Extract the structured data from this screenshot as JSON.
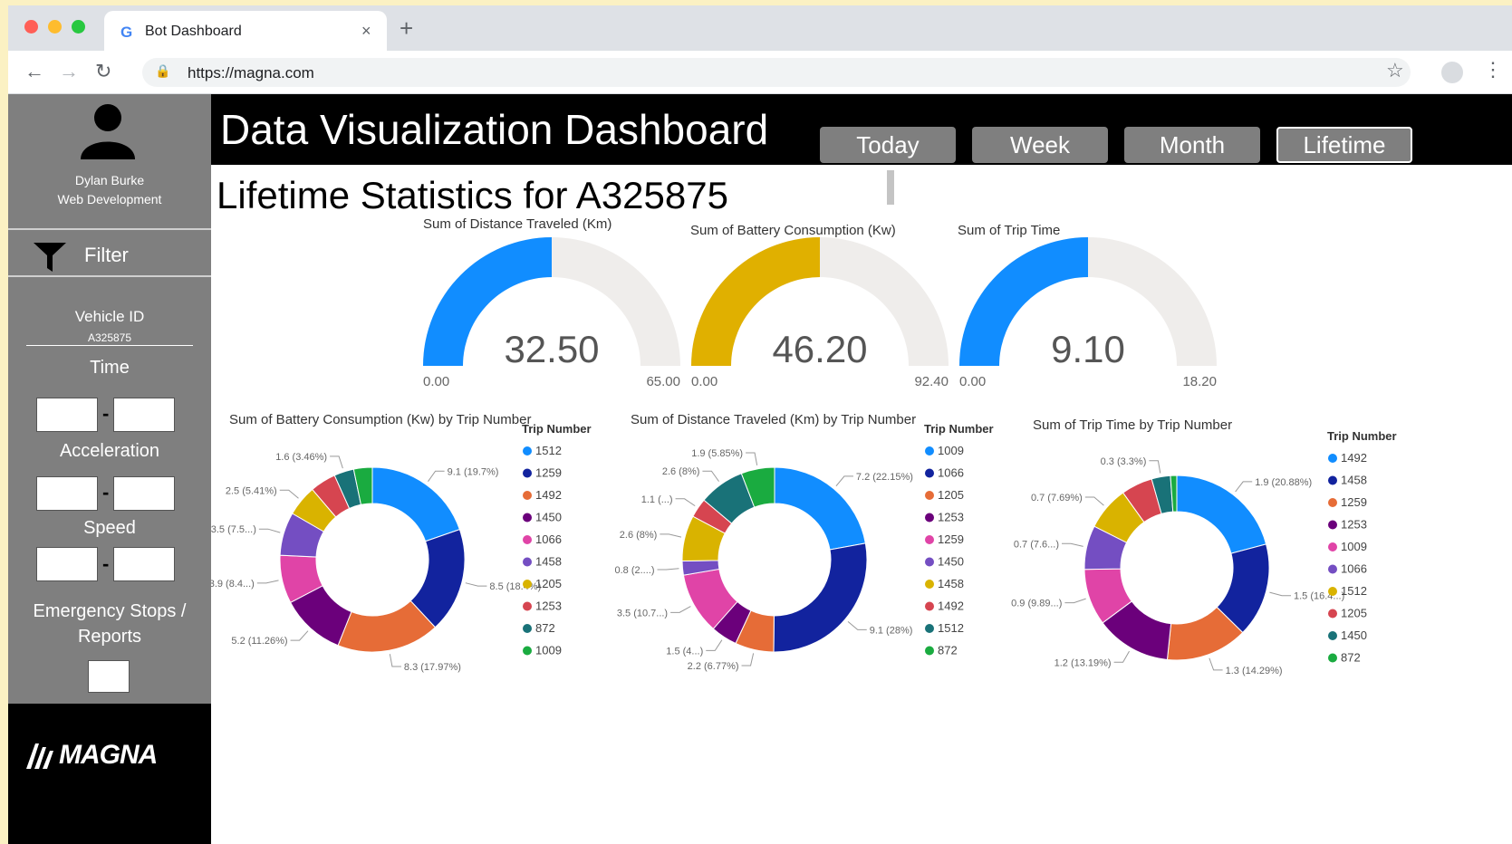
{
  "browser": {
    "tab_title": "Bot Dashboard",
    "url": "https://magna.com",
    "tab_close": "×",
    "new_tab": "+"
  },
  "sidebar": {
    "user_name": "Dylan Burke",
    "user_dept": "Web Development",
    "filter_label": "Filter",
    "vehicle_id_label": "Vehicle ID",
    "vehicle_id_value": "A325875",
    "time_label": "Time",
    "acceleration_label": "Acceleration",
    "speed_label": "Speed",
    "emergency_label_1": "Emergency Stops /",
    "emergency_label_2": "Reports",
    "range_dash": "-",
    "logo_text": "MAGNA"
  },
  "header": {
    "title": "Data Visualization Dashboard",
    "ranges": [
      "Today",
      "Week",
      "Month",
      "Lifetime"
    ],
    "active_range": "Lifetime"
  },
  "main": {
    "stats_title": "Lifetime Statistics for A325875"
  },
  "chart_data": [
    {
      "type": "gauge",
      "title": "Sum of Distance Traveled (Km)",
      "value": 32.5,
      "value_label": "32.50",
      "min": 0,
      "min_label": "0.00",
      "max": 65,
      "max_label": "65.00",
      "color": "#118dff"
    },
    {
      "type": "gauge",
      "title": "Sum of Battery Consumption (Kw)",
      "value": 46.2,
      "value_label": "46.20",
      "min": 0,
      "min_label": "0.00",
      "max": 92.4,
      "max_label": "92.40",
      "color": "#e0b000"
    },
    {
      "type": "gauge",
      "title": "Sum of Trip Time",
      "value": 9.1,
      "value_label": "9.10",
      "min": 0,
      "min_label": "0.00",
      "max": 18.2,
      "max_label": "18.20",
      "color": "#118dff"
    },
    {
      "type": "pie",
      "title": "Sum of Battery Consumption (Kw) by Trip Number",
      "legend_title": "Trip Number",
      "slices": [
        {
          "name": "1512",
          "value": 9.1,
          "label": "9.1 (19.7%)",
          "color": "#118dff"
        },
        {
          "name": "1259",
          "value": 8.5,
          "label": "8.5 (18.4%)",
          "color": "#12239e"
        },
        {
          "name": "1492",
          "value": 8.3,
          "label": "8.3 (17.97%)",
          "color": "#e66c37"
        },
        {
          "name": "1450",
          "value": 5.2,
          "label": "5.2 (11.26%)",
          "color": "#6b007b"
        },
        {
          "name": "1066",
          "value": 3.9,
          "label": "3.9 (8.4...)",
          "color": "#e044a7"
        },
        {
          "name": "1458",
          "value": 3.5,
          "label": "3.5 (7.5...)",
          "color": "#744ec2"
        },
        {
          "name": "1205",
          "value": 2.5,
          "label": "2.5 (5.41%)",
          "color": "#d9b300"
        },
        {
          "name": "1253",
          "value": 2.1,
          "label": "",
          "color": "#d64550"
        },
        {
          "name": "872",
          "value": 1.6,
          "label": "1.6 (3.46%)",
          "color": "#197278"
        },
        {
          "name": "1009",
          "value": 1.5,
          "label": "",
          "color": "#1aab40"
        }
      ]
    },
    {
      "type": "pie",
      "title": "Sum of Distance Traveled (Km) by Trip Number",
      "legend_title": "Trip Number",
      "slices": [
        {
          "name": "1009",
          "value": 7.2,
          "label": "7.2 (22.15%)",
          "color": "#118dff"
        },
        {
          "name": "1066",
          "value": 9.1,
          "label": "9.1 (28%)",
          "color": "#12239e"
        },
        {
          "name": "1205",
          "value": 2.2,
          "label": "2.2 (6.77%)",
          "color": "#e66c37"
        },
        {
          "name": "1253",
          "value": 1.5,
          "label": "1.5 (4...)",
          "color": "#6b007b"
        },
        {
          "name": "1259",
          "value": 3.5,
          "label": "3.5 (10.7...)",
          "color": "#e044a7"
        },
        {
          "name": "1450",
          "value": 0.8,
          "label": "0.8 (2....)",
          "color": "#744ec2"
        },
        {
          "name": "1458",
          "value": 2.6,
          "label": "2.6 (8%)",
          "color": "#d9b300"
        },
        {
          "name": "1492",
          "value": 1.1,
          "label": "1.1 (...)",
          "color": "#d64550"
        },
        {
          "name": "1512",
          "value": 2.6,
          "label": "2.6 (8%)",
          "color": "#197278"
        },
        {
          "name": "872",
          "value": 1.9,
          "label": "1.9 (5.85%)",
          "color": "#1aab40"
        }
      ]
    },
    {
      "type": "pie",
      "title": "Sum of Trip Time by Trip Number",
      "legend_title": "Trip Number",
      "slices": [
        {
          "name": "1492",
          "value": 1.9,
          "label": "1.9 (20.88%)",
          "color": "#118dff"
        },
        {
          "name": "1458",
          "value": 1.5,
          "label": "1.5 (16.4...)",
          "color": "#12239e"
        },
        {
          "name": "1259",
          "value": 1.3,
          "label": "1.3 (14.29%)",
          "color": "#e66c37"
        },
        {
          "name": "1253",
          "value": 1.2,
          "label": "1.2 (13.19%)",
          "color": "#6b007b"
        },
        {
          "name": "1009",
          "value": 0.9,
          "label": "0.9 (9.89...)",
          "color": "#e044a7"
        },
        {
          "name": "1066",
          "value": 0.7,
          "label": "0.7 (7.6...)",
          "color": "#744ec2"
        },
        {
          "name": "1512",
          "value": 0.7,
          "label": "0.7 (7.69%)",
          "color": "#d9b300"
        },
        {
          "name": "1205",
          "value": 0.5,
          "label": "",
          "color": "#d64550"
        },
        {
          "name": "1450",
          "value": 0.3,
          "label": "0.3 (3.3%)",
          "color": "#197278"
        },
        {
          "name": "872",
          "value": 0.1,
          "label": "",
          "color": "#1aab40"
        }
      ]
    }
  ]
}
